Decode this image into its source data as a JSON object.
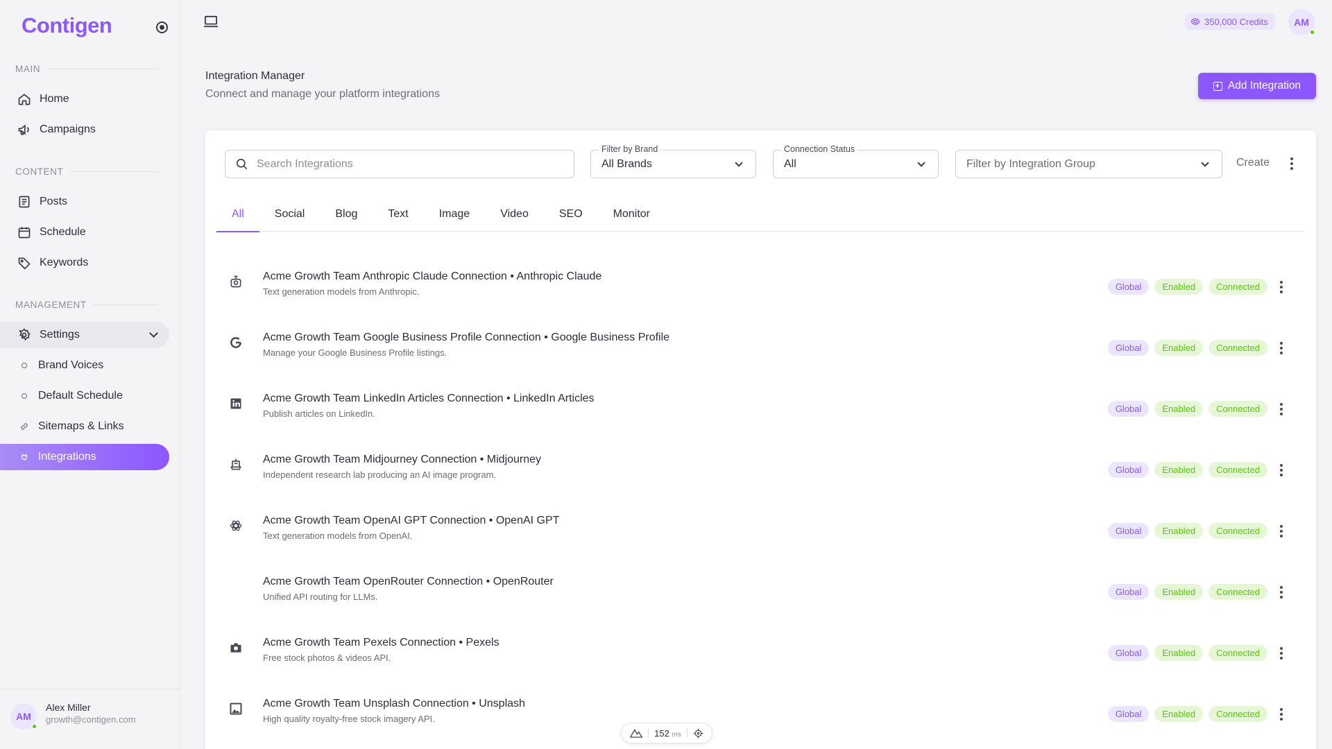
{
  "brand": {
    "name": "Contigen"
  },
  "sidebar": {
    "sections": {
      "main": "MAIN",
      "content": "CONTENT",
      "management": "MANAGEMENT"
    },
    "items": {
      "home": "Home",
      "campaigns": "Campaigns",
      "posts": "Posts",
      "schedule": "Schedule",
      "keywords": "Keywords",
      "settings": "Settings",
      "brand_voices": "Brand Voices",
      "default_schedule": "Default Schedule",
      "sitemaps": "Sitemaps & Links",
      "integrations": "Integrations"
    },
    "user": {
      "initials": "AM",
      "name": "Alex Miller",
      "email": "growth@contigen.com"
    }
  },
  "topbar": {
    "credits": "350,000 Credits",
    "avatar_initials": "AM"
  },
  "page": {
    "title": "Integration Manager",
    "subtitle": "Connect and manage your platform integrations",
    "add_button": "Add Integration"
  },
  "filters": {
    "search_placeholder": "Search Integrations",
    "brand": {
      "label": "Filter by Brand",
      "value": "All Brands"
    },
    "status": {
      "label": "Connection Status",
      "value": "All"
    },
    "group": {
      "placeholder": "Filter by Integration Group"
    },
    "create": "Create"
  },
  "tabs": [
    "All",
    "Social",
    "Blog",
    "Text",
    "Image",
    "Video",
    "SEO",
    "Monitor"
  ],
  "active_tab": "All",
  "integrations": [
    {
      "icon": "robot-icon",
      "title": "Acme Growth Team Anthropic Claude Connection • Anthropic Claude",
      "desc": "Text generation models from Anthropic.",
      "chips": [
        "Global",
        "Enabled",
        "Connected"
      ]
    },
    {
      "icon": "google-icon",
      "title": "Acme Growth Team Google Business Profile Connection • Google Business Profile",
      "desc": "Manage your Google Business Profile listings.",
      "chips": [
        "Global",
        "Enabled",
        "Connected"
      ]
    },
    {
      "icon": "linkedin-icon",
      "title": "Acme Growth Team LinkedIn Articles Connection • LinkedIn Articles",
      "desc": "Publish articles on LinkedIn.",
      "chips": [
        "Global",
        "Enabled",
        "Connected"
      ]
    },
    {
      "icon": "sailboat-icon",
      "title": "Acme Growth Team Midjourney Connection • Midjourney",
      "desc": "Independent research lab producing an AI image program.",
      "chips": [
        "Global",
        "Enabled",
        "Connected"
      ]
    },
    {
      "icon": "openai-icon",
      "title": "Acme Growth Team OpenAI GPT Connection • OpenAI GPT",
      "desc": "Text generation models from OpenAI.",
      "chips": [
        "Global",
        "Enabled",
        "Connected"
      ]
    },
    {
      "icon": "",
      "title": "Acme Growth Team OpenRouter Connection • OpenRouter",
      "desc": "Unified API routing for LLMs.",
      "chips": [
        "Global",
        "Enabled",
        "Connected"
      ]
    },
    {
      "icon": "camera-icon",
      "title": "Acme Growth Team Pexels Connection • Pexels",
      "desc": "Free stock photos & videos API.",
      "chips": [
        "Global",
        "Enabled",
        "Connected"
      ]
    },
    {
      "icon": "image-icon",
      "title": "Acme Growth Team Unsplash Connection • Unsplash",
      "desc": "High quality royalty-free stock imagery API.",
      "chips": [
        "Global",
        "Enabled",
        "Connected"
      ]
    }
  ],
  "perf": {
    "value": "152",
    "unit": "ms"
  },
  "colors": {
    "accent": "#8c57ff",
    "success": "#56ca00",
    "text": "#2f2b3d",
    "muted": "#6d6b77"
  }
}
